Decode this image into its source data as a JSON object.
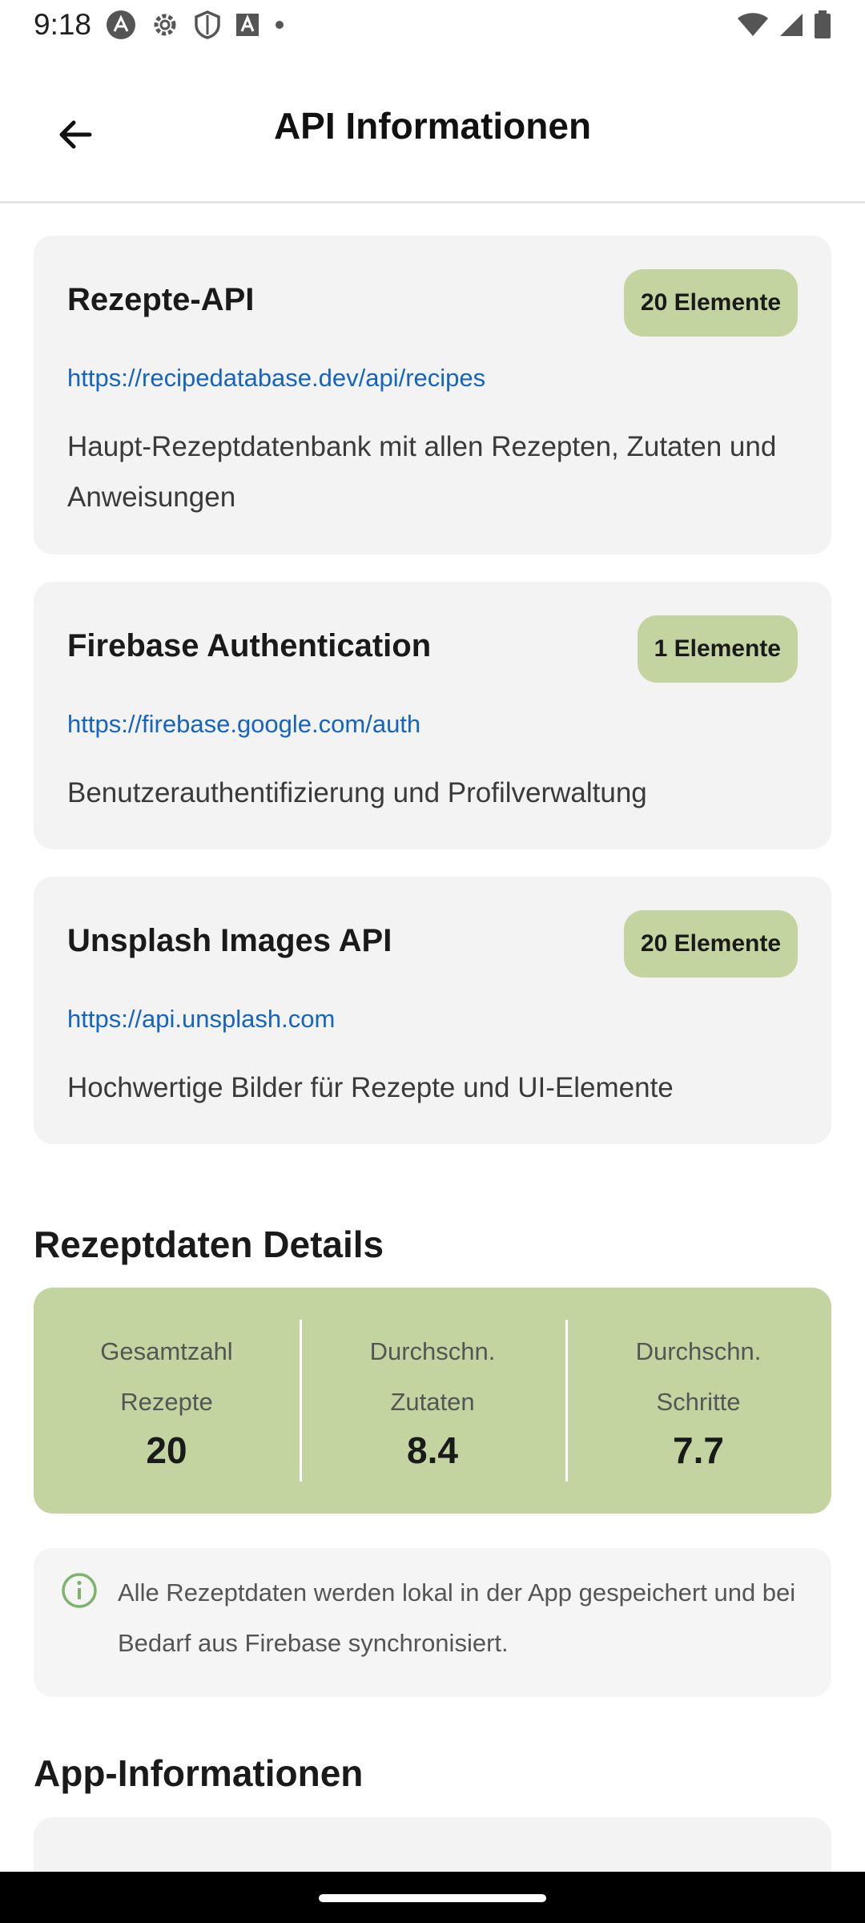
{
  "status_bar": {
    "time": "9:18",
    "icons_left": [
      "app-a-icon",
      "settings-icon",
      "shield-icon",
      "font-icon",
      "dot-icon"
    ],
    "icons_right": [
      "wifi-icon",
      "signal-icon",
      "battery-icon"
    ]
  },
  "app_bar": {
    "title": "API Informationen",
    "back_icon": "arrow-back-icon"
  },
  "apis": [
    {
      "name": "Rezepte-API",
      "badge": "20 Elemente",
      "url": "https://recipedatabase.dev/api/recipes",
      "description": "Haupt-Rezeptdatenbank mit allen Rezepten, Zutaten und Anweisungen"
    },
    {
      "name": "Firebase Authentication",
      "badge": "1 Elemente",
      "url": "https://firebase.google.com/auth",
      "description": "Benutzerauthentifizierung und Profilverwaltung"
    },
    {
      "name": "Unsplash Images API",
      "badge": "20 Elemente",
      "url": "https://api.unsplash.com",
      "description": "Hochwertige Bilder für Rezepte und UI-Elemente"
    }
  ],
  "recipe_details": {
    "title": "Rezeptdaten Details",
    "stats": [
      {
        "label": "Gesamtzahl\nRezepte",
        "value": "20"
      },
      {
        "label": "Durchschn.\nZutaten",
        "value": "8.4"
      },
      {
        "label": "Durchschn.\nSchritte",
        "value": "7.7"
      }
    ]
  },
  "info_note": {
    "icon": "info-icon",
    "text": "Alle Rezeptdaten werden lokal in der App gespeichert und bei Bedarf aus Firebase synchronisiert."
  },
  "app_info": {
    "title": "App-Informationen"
  },
  "colors": {
    "badge_bg": "#c4d4a0",
    "stats_bg": "#c4d4a0",
    "link": "#1565c0",
    "info_icon": "#7cb46a",
    "card_bg": "#f3f3f3"
  }
}
